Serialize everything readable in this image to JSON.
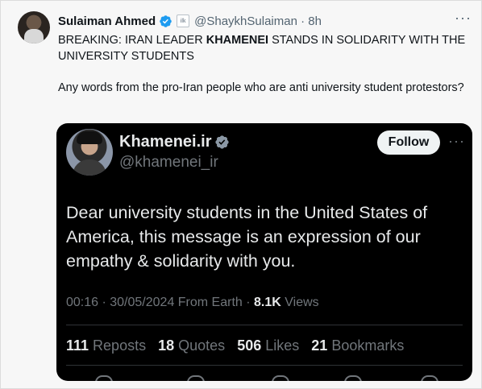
{
  "author": {
    "name": "Sulaiman Ahmed",
    "affiliate_label": "ilk",
    "handle_time": "@ShaykhSulaiman · 8h"
  },
  "tweet": {
    "line_prefix": "BREAKING: IRAN LEADER ",
    "line_bold": "KHAMENEI",
    "line_suffix": " STANDS IN SOLIDARITY WITH THE UNIVERSITY STUDENTS",
    "paragraph2": "Any words from the pro-Iran people who are anti university student protestors?"
  },
  "more_glyph": "···",
  "quote": {
    "name": "Khamenei.ir",
    "handle": "@khamenei_ir",
    "follow_label": "Follow",
    "body": "Dear university students in the United States of America, this message is an expression of our empathy & solidarity with you.",
    "meta_prefix": "00:16 · 30/05/2024 From Earth · ",
    "views_count": "8.1K",
    "views_label": " Views",
    "stats": [
      {
        "num": "111",
        "label": " Reposts"
      },
      {
        "num": "18",
        "label": " Quotes"
      },
      {
        "num": "506",
        "label": " Likes"
      },
      {
        "num": "21",
        "label": " Bookmarks"
      }
    ]
  },
  "colors": {
    "verified": "#1d9bf0",
    "quote_verified": "#8b98a5"
  }
}
